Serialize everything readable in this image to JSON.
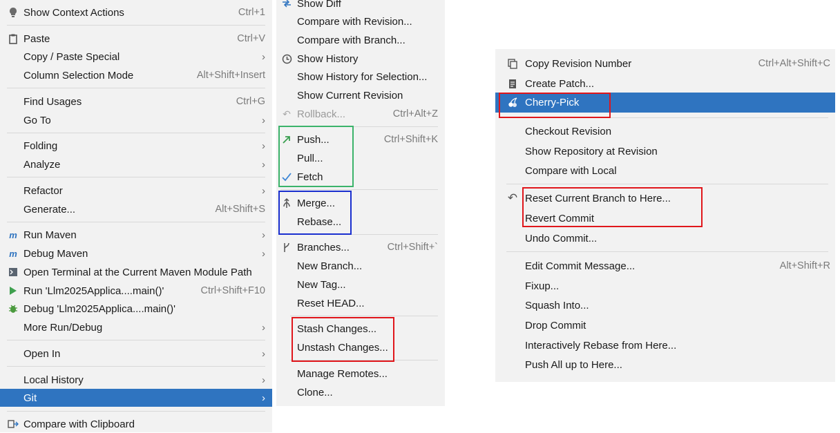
{
  "menu_left": {
    "items": [
      {
        "label": "Show Context Actions",
        "shortcut": "Ctrl+1",
        "icon": "lightbulb-icon"
      },
      {
        "label": "Paste",
        "shortcut": "Ctrl+V",
        "icon": "clipboard-icon"
      },
      {
        "label": "Copy / Paste Special",
        "submenu": true
      },
      {
        "label": "Column Selection Mode",
        "shortcut": "Alt+Shift+Insert"
      },
      {
        "label": "Find Usages",
        "shortcut": "Ctrl+G"
      },
      {
        "label": "Go To",
        "submenu": true
      },
      {
        "label": "Folding",
        "submenu": true
      },
      {
        "label": "Analyze",
        "submenu": true
      },
      {
        "label": "Refactor",
        "submenu": true
      },
      {
        "label": "Generate...",
        "shortcut": "Alt+Shift+S"
      },
      {
        "label": "Run Maven",
        "submenu": true,
        "icon": "maven-icon"
      },
      {
        "label": "Debug Maven",
        "submenu": true,
        "icon": "maven-debug-icon"
      },
      {
        "label": "Open Terminal at the Current Maven Module Path",
        "icon": "terminal-icon"
      },
      {
        "label": "Run 'Llm2025Applica....main()'",
        "shortcut": "Ctrl+Shift+F10",
        "icon": "run-icon"
      },
      {
        "label": "Debug 'Llm2025Applica....main()'",
        "icon": "debug-bug-icon"
      },
      {
        "label": "More Run/Debug",
        "submenu": true
      },
      {
        "label": "Open In",
        "submenu": true
      },
      {
        "label": "Local History",
        "submenu": true
      },
      {
        "label": "Git",
        "submenu": true,
        "selected": true
      },
      {
        "label": "Compare with Clipboard",
        "icon": "compare-clipboard-icon"
      }
    ]
  },
  "menu_git": {
    "items": [
      {
        "label": "Show Diff",
        "icon": "diff-icon"
      },
      {
        "label": "Compare with Revision..."
      },
      {
        "label": "Compare with Branch..."
      },
      {
        "label": "Show History",
        "icon": "clock-icon"
      },
      {
        "label": "Show History for Selection..."
      },
      {
        "label": "Show Current Revision"
      },
      {
        "label": "Rollback...",
        "shortcut": "Ctrl+Alt+Z",
        "disabled": true,
        "icon": "rollback-icon"
      },
      {
        "label": "Push...",
        "shortcut": "Ctrl+Shift+K",
        "icon": "push-arrow-icon"
      },
      {
        "label": "Pull..."
      },
      {
        "label": "Fetch",
        "icon": "fetch-check-icon"
      },
      {
        "label": "Merge...",
        "icon": "merge-icon"
      },
      {
        "label": "Rebase..."
      },
      {
        "label": "Branches...",
        "shortcut": "Ctrl+Shift+`",
        "icon": "branch-icon"
      },
      {
        "label": "New Branch..."
      },
      {
        "label": "New Tag..."
      },
      {
        "label": "Reset HEAD..."
      },
      {
        "label": "Stash Changes..."
      },
      {
        "label": "Unstash Changes..."
      },
      {
        "label": "Manage Remotes..."
      },
      {
        "label": "Clone..."
      }
    ]
  },
  "menu_commit": {
    "items": [
      {
        "label": "Copy Revision Number",
        "shortcut": "Ctrl+Alt+Shift+C",
        "icon": "copy-icon"
      },
      {
        "label": "Create Patch...",
        "icon": "patch-icon"
      },
      {
        "label": "Cherry-Pick",
        "selected": true,
        "icon": "cherry-icon"
      },
      {
        "label": "Checkout Revision"
      },
      {
        "label": "Show Repository at Revision"
      },
      {
        "label": "Compare with Local"
      },
      {
        "label": "Reset Current Branch to Here...",
        "icon": "reset-icon"
      },
      {
        "label": "Revert Commit"
      },
      {
        "label": "Undo Commit..."
      },
      {
        "label": "Edit Commit Message...",
        "shortcut": "Alt+Shift+R"
      },
      {
        "label": "Fixup..."
      },
      {
        "label": "Squash Into..."
      },
      {
        "label": "Drop Commit"
      },
      {
        "label": "Interactively Rebase from Here..."
      },
      {
        "label": "Push All up to Here..."
      }
    ]
  },
  "colors": {
    "selection": "#2f74c0",
    "highlight_red": "#e0161b",
    "highlight_green": "#3bb36a",
    "highlight_blue": "#1a2fcf"
  }
}
